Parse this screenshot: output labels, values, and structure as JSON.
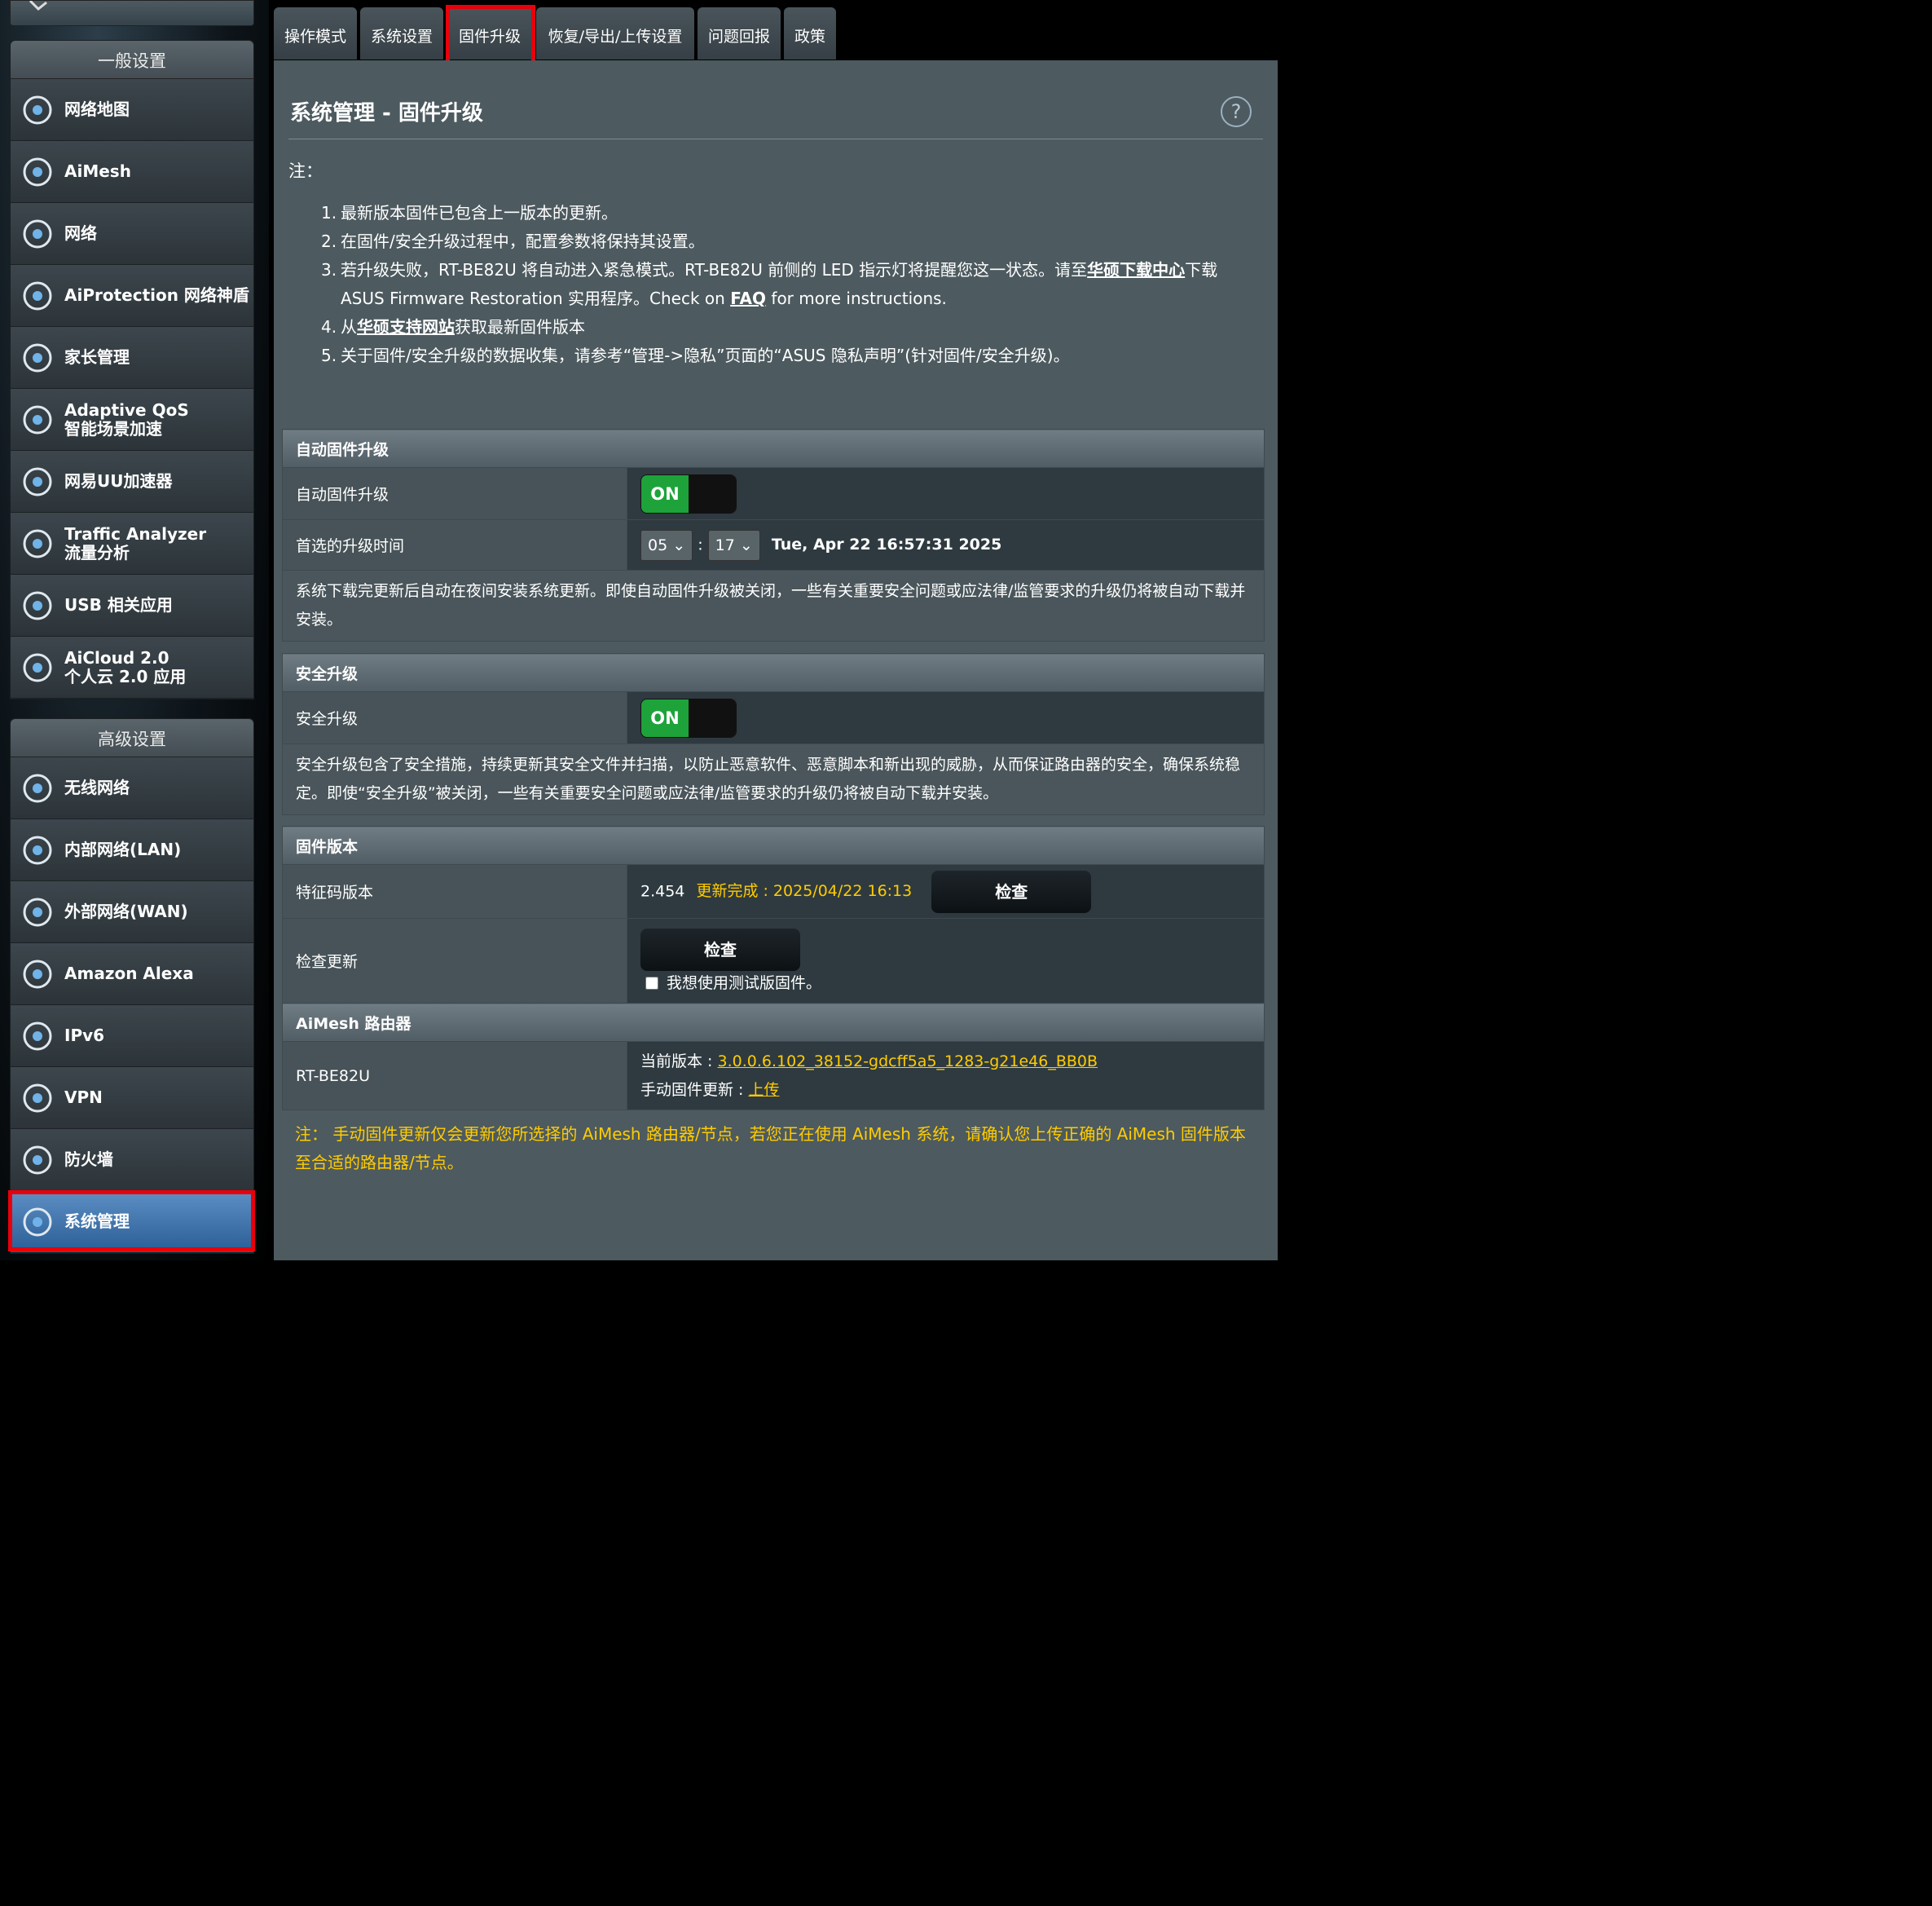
{
  "tabs": [
    {
      "label": "操作模式"
    },
    {
      "label": "系统设置"
    },
    {
      "label": "固件升级"
    },
    {
      "label": "恢复/导出/上传设置"
    },
    {
      "label": "问题回报"
    },
    {
      "label": "政策"
    }
  ],
  "sidebar": {
    "general_header": "一般设置",
    "general_items": [
      {
        "label": "网络地图",
        "icon": "network-map-icon"
      },
      {
        "label": "AiMesh",
        "icon": "aimesh-icon"
      },
      {
        "label": "网络",
        "icon": "guest-network-icon"
      },
      {
        "label": "AiProtection 网络神盾",
        "icon": "aiprotection-icon"
      },
      {
        "label": "家长管理",
        "icon": "parental-control-icon"
      },
      {
        "label": "Adaptive QoS",
        "label2": "智能场景加速",
        "icon": "qos-icon"
      },
      {
        "label": "网易UU加速器",
        "icon": "uu-accelerator-icon"
      },
      {
        "label": "Traffic Analyzer",
        "label2": "流量分析",
        "icon": "traffic-analyzer-icon"
      },
      {
        "label": "USB 相关应用",
        "icon": "usb-icon"
      },
      {
        "label": "AiCloud 2.0",
        "label2": "个人云 2.0 应用",
        "icon": "aicloud-icon"
      }
    ],
    "advanced_header": "高级设置",
    "advanced_items": [
      {
        "label": "无线网络",
        "icon": "wireless-icon"
      },
      {
        "label": "内部网络(LAN)",
        "icon": "lan-icon"
      },
      {
        "label": "外部网络(WAN)",
        "icon": "wan-icon"
      },
      {
        "label": "Amazon Alexa",
        "icon": "alexa-icon"
      },
      {
        "label": "IPv6",
        "icon": "ipv6-icon"
      },
      {
        "label": "VPN",
        "icon": "vpn-icon"
      },
      {
        "label": "防火墙",
        "icon": "firewall-icon"
      },
      {
        "label": "系统管理",
        "icon": "administration-icon"
      }
    ]
  },
  "page": {
    "title": "系统管理 - 固件升级",
    "help": "?",
    "notes_title": "注：",
    "notes": {
      "n1": "最新版本固件已包含上一版本的更新。",
      "n2": "在固件/安全升级过程中，配置参数将保持其设置。",
      "n3a": "若升级失败，RT-BE82U 将自动进入紧急模式。RT-BE82U 前侧的 LED 指示灯将提醒您这一状态。请至",
      "n3_link": "华硕下载中心",
      "n3b": "下载",
      "n3c": "ASUS Firmware Restoration 实用程序。Check on ",
      "n3_faq": "FAQ",
      "n3d": " for more instructions.",
      "n4a": "从",
      "n4_link": "华硕支持网站",
      "n4b": "获取最新固件版本",
      "n5": "关于固件/安全升级的数据收集，请参考“管理->隐私”页面的“ASUS 隐私声明”(针对固件/安全升级)。"
    }
  },
  "auto_upgrade": {
    "header": "自动固件升级",
    "label": "自动固件升级",
    "toggle": "ON",
    "time_label": "首选的升级时间",
    "hour": "05",
    "minute": "17",
    "separator": ":",
    "datetime": "Tue, Apr 22 16:57:31 2025",
    "desc": "系统下载完更新后自动在夜间安装系统更新。即使自动固件升级被关闭，一些有关重要安全问题或应法律/监管要求的升级仍将被自动下载并安装。"
  },
  "security_upgrade": {
    "header": "安全升级",
    "label": "安全升级",
    "toggle": "ON",
    "desc": "安全升级包含了安全措施，持续更新其安全文件并扫描，以防止恶意软件、恶意脚本和新出现的威胁，从而保证路由器的安全，确保系统稳定。即使“安全升级”被关闭，一些有关重要安全问题或应法律/监管要求的升级仍将被自动下载并安装。"
  },
  "firmware_version": {
    "header": "固件版本",
    "signature_label": "特征码版本",
    "signature_value": "2.454",
    "signature_status": "更新完成 : 2025/04/22 16:13",
    "signature_button": "检查",
    "check_label": "检查更新",
    "check_button": "检查",
    "beta_label": "我想使用测试版固件。"
  },
  "aimesh_router": {
    "header": "AiMesh 路由器",
    "model": "RT-BE82U",
    "current_label": "当前版本 : ",
    "current_version": "3.0.0.6.102_38152-gdcff5a5_1283-g21e46_BB0B",
    "manual_label": "手动固件更新 : ",
    "upload_link": "上传"
  },
  "warning": "注： 手动固件更新仅会更新您所选择的 AiMesh 路由器/节点，若您正在使用 AiMesh 系统，请确认您上传正确的 AiMesh 固件版本至合适的路由器/节点。",
  "colors": {
    "accent": "#ffcc00",
    "toggle_on": "#1ea33a",
    "highlight": "#e8000b"
  }
}
